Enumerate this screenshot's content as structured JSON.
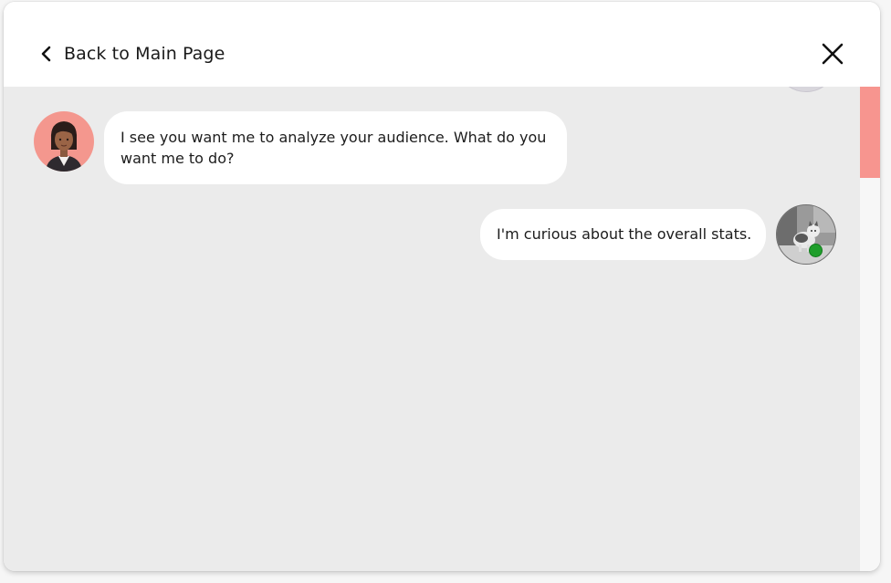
{
  "header": {
    "back_label": "Back to Main Page",
    "back_icon": "chevron-left-icon",
    "close_icon": "close-icon"
  },
  "chat": {
    "messages": [
      {
        "sender": "agent",
        "avatar_icon": "agent-avatar",
        "text": "I see you want me to analyze your audience. What do you want me to do?"
      },
      {
        "sender": "user",
        "avatar_icon": "user-avatar-cat",
        "text": "I'm curious about the overall stats.",
        "status": "online"
      }
    ]
  },
  "colors": {
    "chat_background": "#ebebeb",
    "bubble_background": "#ffffff",
    "agent_avatar_background": "#f4978e",
    "scrollbar_thumb": "#f7958f",
    "online_indicator": "#1f9e2b"
  }
}
